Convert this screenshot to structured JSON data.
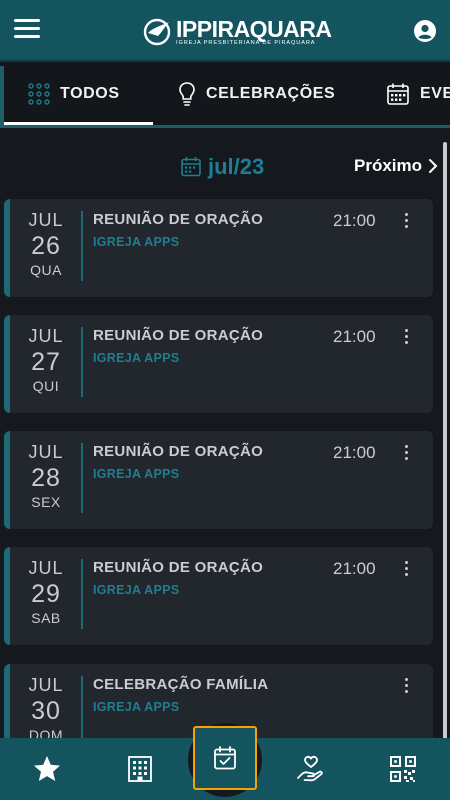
{
  "app": {
    "title": "IPPIRAQUARA",
    "subtitle": "IGREJA PRESBITERIANA DE PIRAQUARA"
  },
  "icons": {
    "menu": "hamburger-menu-icon",
    "profile": "user-circle-icon",
    "tab_all": "grid-dots-icon",
    "tab_celebrations": "lightbulb-icon",
    "tab_events": "calendar-icon",
    "month": "calendar-icon",
    "next": "chevron-right-icon",
    "more": "more-vertical-icon",
    "nav_favorites": "star-icon",
    "nav_building": "building-icon",
    "nav_calendar": "calendar-check-icon",
    "nav_donate": "hand-heart-icon",
    "nav_qr": "qr-code-icon"
  },
  "colors": {
    "brand": "#14545f",
    "accent": "#1d7f91",
    "highlight": "#f5a300",
    "background": "#15191e",
    "card": "#22272d"
  },
  "tabs": [
    {
      "label": "TODOS",
      "active": true
    },
    {
      "label": "CELEBRAÇÕES",
      "active": false
    },
    {
      "label": "EVENTOS",
      "active": false
    }
  ],
  "calendar": {
    "month_label": "jul/23",
    "next_label": "Próximo"
  },
  "events": [
    {
      "month": "JUL",
      "day": "26",
      "weekday": "QUA",
      "title": "REUNIÃO DE ORAÇÃO",
      "organizer": "IGREJA APPS",
      "time": "21:00"
    },
    {
      "month": "JUL",
      "day": "27",
      "weekday": "QUI",
      "title": "REUNIÃO DE ORAÇÃO",
      "organizer": "IGREJA APPS",
      "time": "21:00"
    },
    {
      "month": "JUL",
      "day": "28",
      "weekday": "SEX",
      "title": "REUNIÃO DE ORAÇÃO",
      "organizer": "IGREJA APPS",
      "time": "21:00"
    },
    {
      "month": "JUL",
      "day": "29",
      "weekday": "SAB",
      "title": "REUNIÃO DE ORAÇÃO",
      "organizer": "IGREJA APPS",
      "time": "21:00"
    },
    {
      "month": "JUL",
      "day": "30",
      "weekday": "DOM",
      "title": "CELEBRAÇÃO FAMÍLIA",
      "organizer": "IGREJA APPS",
      "time": ""
    }
  ]
}
